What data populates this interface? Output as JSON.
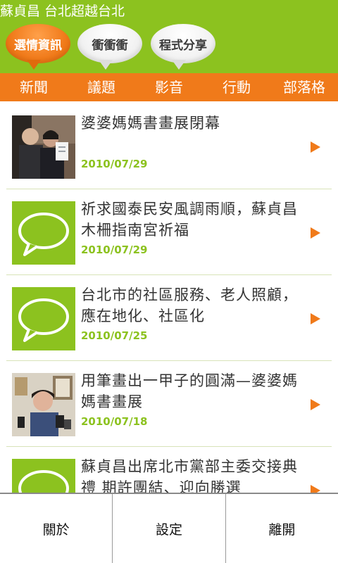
{
  "app": {
    "title": "蘇貞昌 台北超越台北"
  },
  "top_tabs": [
    {
      "label": "選情資訊",
      "active": true
    },
    {
      "label": "衝衝衝",
      "active": false
    },
    {
      "label": "程式分享",
      "active": false
    }
  ],
  "categories": [
    "新聞",
    "議題",
    "影音",
    "行動",
    "部落格"
  ],
  "news": [
    {
      "title": "婆婆媽媽書畫展閉幕",
      "date": "2010/07/29",
      "thumb": "photo"
    },
    {
      "title": "祈求國泰民安風調雨順，蘇貞昌木柵指南宮祈福",
      "date": "2010/07/29",
      "thumb": "speech-bubble-icon"
    },
    {
      "title": "台北市的社區服務、老人照顧，應在地化、社區化",
      "date": "2010/07/25",
      "thumb": "speech-bubble-icon"
    },
    {
      "title": "用筆畫出一甲子的圓滿—婆婆媽媽書畫展",
      "date": "2010/07/18",
      "thumb": "photo"
    },
    {
      "title": "蘇貞昌出席北市黨部主委交接典禮 期許團結、迎向勝選",
      "date": "",
      "thumb": "speech-bubble-icon"
    }
  ],
  "menu": {
    "about": "關於",
    "settings": "設定",
    "exit": "離開"
  },
  "colors": {
    "green": "#8cc21f",
    "orange": "#f07a1a"
  }
}
